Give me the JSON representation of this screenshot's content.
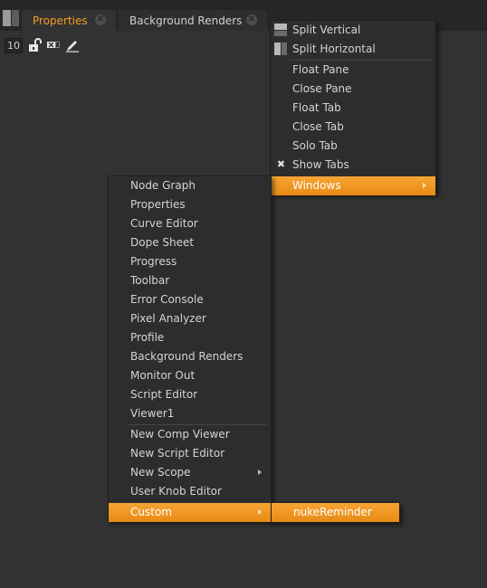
{
  "tabs": [
    {
      "label": "Properties",
      "active": true
    },
    {
      "label": "Background Renders",
      "active": false
    }
  ],
  "toolbar": {
    "max_panels": "10",
    "icons": [
      "lock-icon",
      "clear-panels-icon",
      "edit-pencil-icon"
    ]
  },
  "pane_menu": {
    "items": [
      {
        "label": "Split Vertical",
        "icon": "split-vertical-icon"
      },
      {
        "label": "Split Horizontal",
        "icon": "split-horizontal-icon"
      },
      {
        "label": "Float Pane"
      },
      {
        "label": "Close Pane"
      },
      {
        "label": "Float Tab"
      },
      {
        "label": "Close Tab"
      },
      {
        "label": "Solo Tab"
      },
      {
        "label": "Show Tabs",
        "checked": true
      },
      {
        "label": "Windows",
        "submenu": true,
        "highlighted": true
      }
    ]
  },
  "windows_menu": {
    "items": [
      {
        "label": "Node Graph"
      },
      {
        "label": "Properties"
      },
      {
        "label": "Curve Editor"
      },
      {
        "label": "Dope Sheet"
      },
      {
        "label": "Progress"
      },
      {
        "label": "Toolbar"
      },
      {
        "label": "Error Console"
      },
      {
        "label": "Pixel Analyzer"
      },
      {
        "label": "Profile"
      },
      {
        "label": "Background Renders"
      },
      {
        "label": "Monitor Out"
      },
      {
        "label": "Script Editor"
      },
      {
        "label": "Viewer1"
      },
      {
        "label": "New Comp Viewer"
      },
      {
        "label": "New Script Editor"
      },
      {
        "label": "New Scope",
        "submenu": true
      },
      {
        "label": "User Knob Editor"
      },
      {
        "label": "Custom",
        "submenu": true,
        "highlighted": true
      }
    ]
  },
  "custom_menu": {
    "items": [
      {
        "label": "nukeReminder",
        "highlighted": true
      }
    ]
  },
  "colors": {
    "accent": "#f39c23",
    "highlight": "#f0961e",
    "background": "#323232",
    "tabbar": "#262626"
  }
}
